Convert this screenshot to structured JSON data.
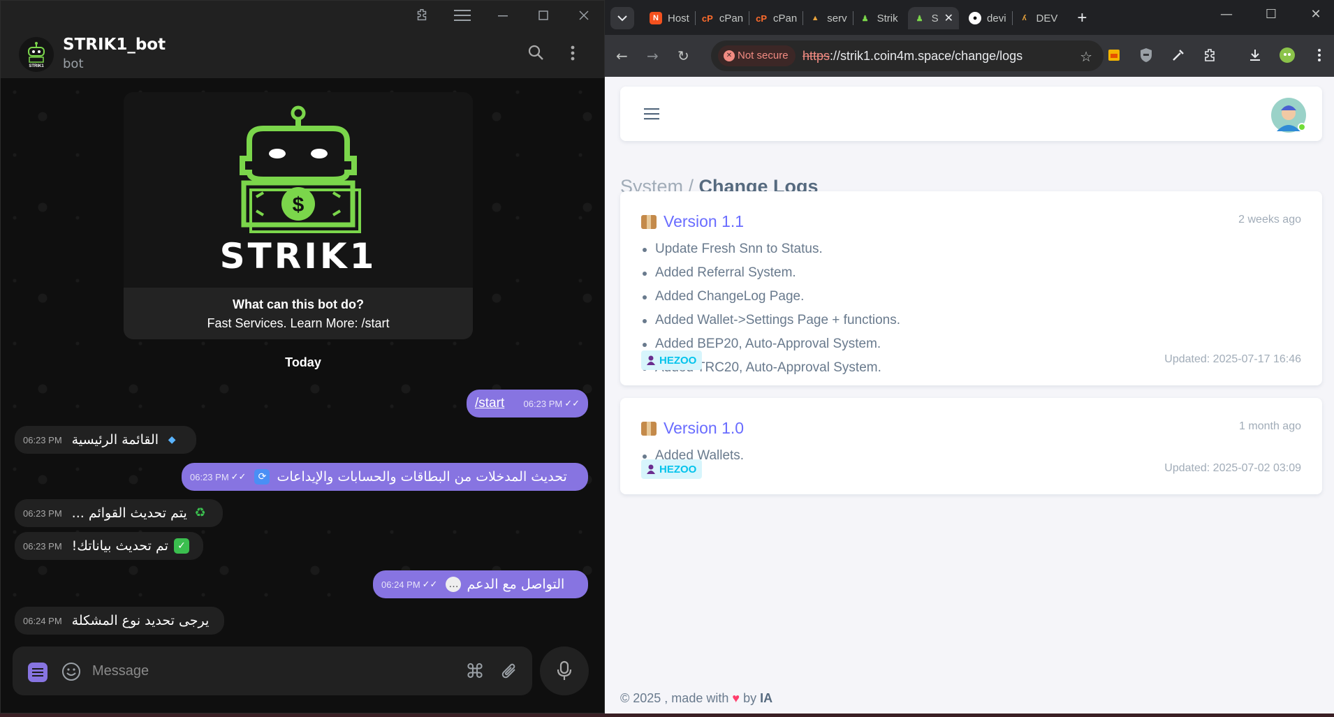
{
  "telegram": {
    "chat_name": "STRIK1_bot",
    "chat_status": "bot",
    "avatar_text": "STRIK1",
    "bot_card": {
      "logo_text": "STRIK1",
      "title": "What can this bot do?",
      "text": "Fast Services. Learn More: /start"
    },
    "date_label": "Today",
    "messages": [
      {
        "dir": "out",
        "text": "/start",
        "time": "06:23 PM"
      },
      {
        "dir": "in",
        "text": "القائمة الرئيسية",
        "emoji": "diamond",
        "time": "06:23 PM"
      },
      {
        "dir": "out",
        "text": "تحديث المدخلات من البطاقات والحسابات والإيداعات",
        "emoji": "refresh",
        "time": "06:23 PM"
      },
      {
        "dir": "in",
        "text": "يتم تحديث القوائم ...",
        "emoji": "recycle",
        "time": "06:23 PM"
      },
      {
        "dir": "in",
        "text": "تم تحديث بياناتك!",
        "emoji": "check",
        "time": "06:23 PM"
      },
      {
        "dir": "out",
        "text": "التواصل مع الدعم",
        "emoji": "speech",
        "time": "06:24 PM"
      },
      {
        "dir": "in",
        "text": "يرجى تحديد نوع المشكلة",
        "time": "06:24 PM"
      }
    ],
    "input_placeholder": "Message"
  },
  "browser": {
    "tabs": [
      {
        "label": "Host",
        "favicon": "host-icon",
        "color": "#f4511e"
      },
      {
        "label": "cPan",
        "favicon": "cpanel-icon",
        "color": "#ff6c2c"
      },
      {
        "label": "cPan",
        "favicon": "cpanel-icon",
        "color": "#ff6c2c"
      },
      {
        "label": "serv",
        "favicon": "server-icon",
        "color": "#e8a33c"
      },
      {
        "label": "Strik",
        "favicon": "strik-icon",
        "color": "#7bd64b"
      },
      {
        "label": "S",
        "favicon": "strik-icon",
        "color": "#7bd64b",
        "active": true
      },
      {
        "label": "devi",
        "favicon": "github-icon",
        "color": "#ffffff"
      },
      {
        "label": "DEV",
        "favicon": "dev-icon",
        "color": "#e8a33c"
      }
    ],
    "security_label": "Not secure",
    "url_scheme": "https",
    "url_rest": "://strik1.coin4m.space/change/logs"
  },
  "page": {
    "breadcrumb_parent": "System /",
    "breadcrumb_current": "Change Logs",
    "changelogs": [
      {
        "version": "Version 1.1",
        "ago": "2 weeks ago",
        "items": [
          "Update Fresh Snn to Status.",
          "Added Referral System.",
          "Added ChangeLog Page.",
          "Added Wallet->Settings Page + functions.",
          "Added BEP20, Auto-Approval System.",
          "Added TRC20, Auto-Approval System."
        ],
        "author": "HEZOO",
        "updated": "Updated: 2025-07-17 16:46"
      },
      {
        "version": "Version 1.0",
        "ago": "1 month ago",
        "items": [
          "Added Wallets."
        ],
        "author": "HEZOO",
        "updated": "Updated: 2025-07-02 03:09"
      }
    ],
    "footer": {
      "prefix": "© 2025 , made with",
      "by": "by",
      "author": "IA"
    }
  },
  "colors": {
    "telegram_accent": "#8774e1",
    "link": "#696cff",
    "badge": "#03c3ec",
    "not_secure": "#f28b82"
  }
}
